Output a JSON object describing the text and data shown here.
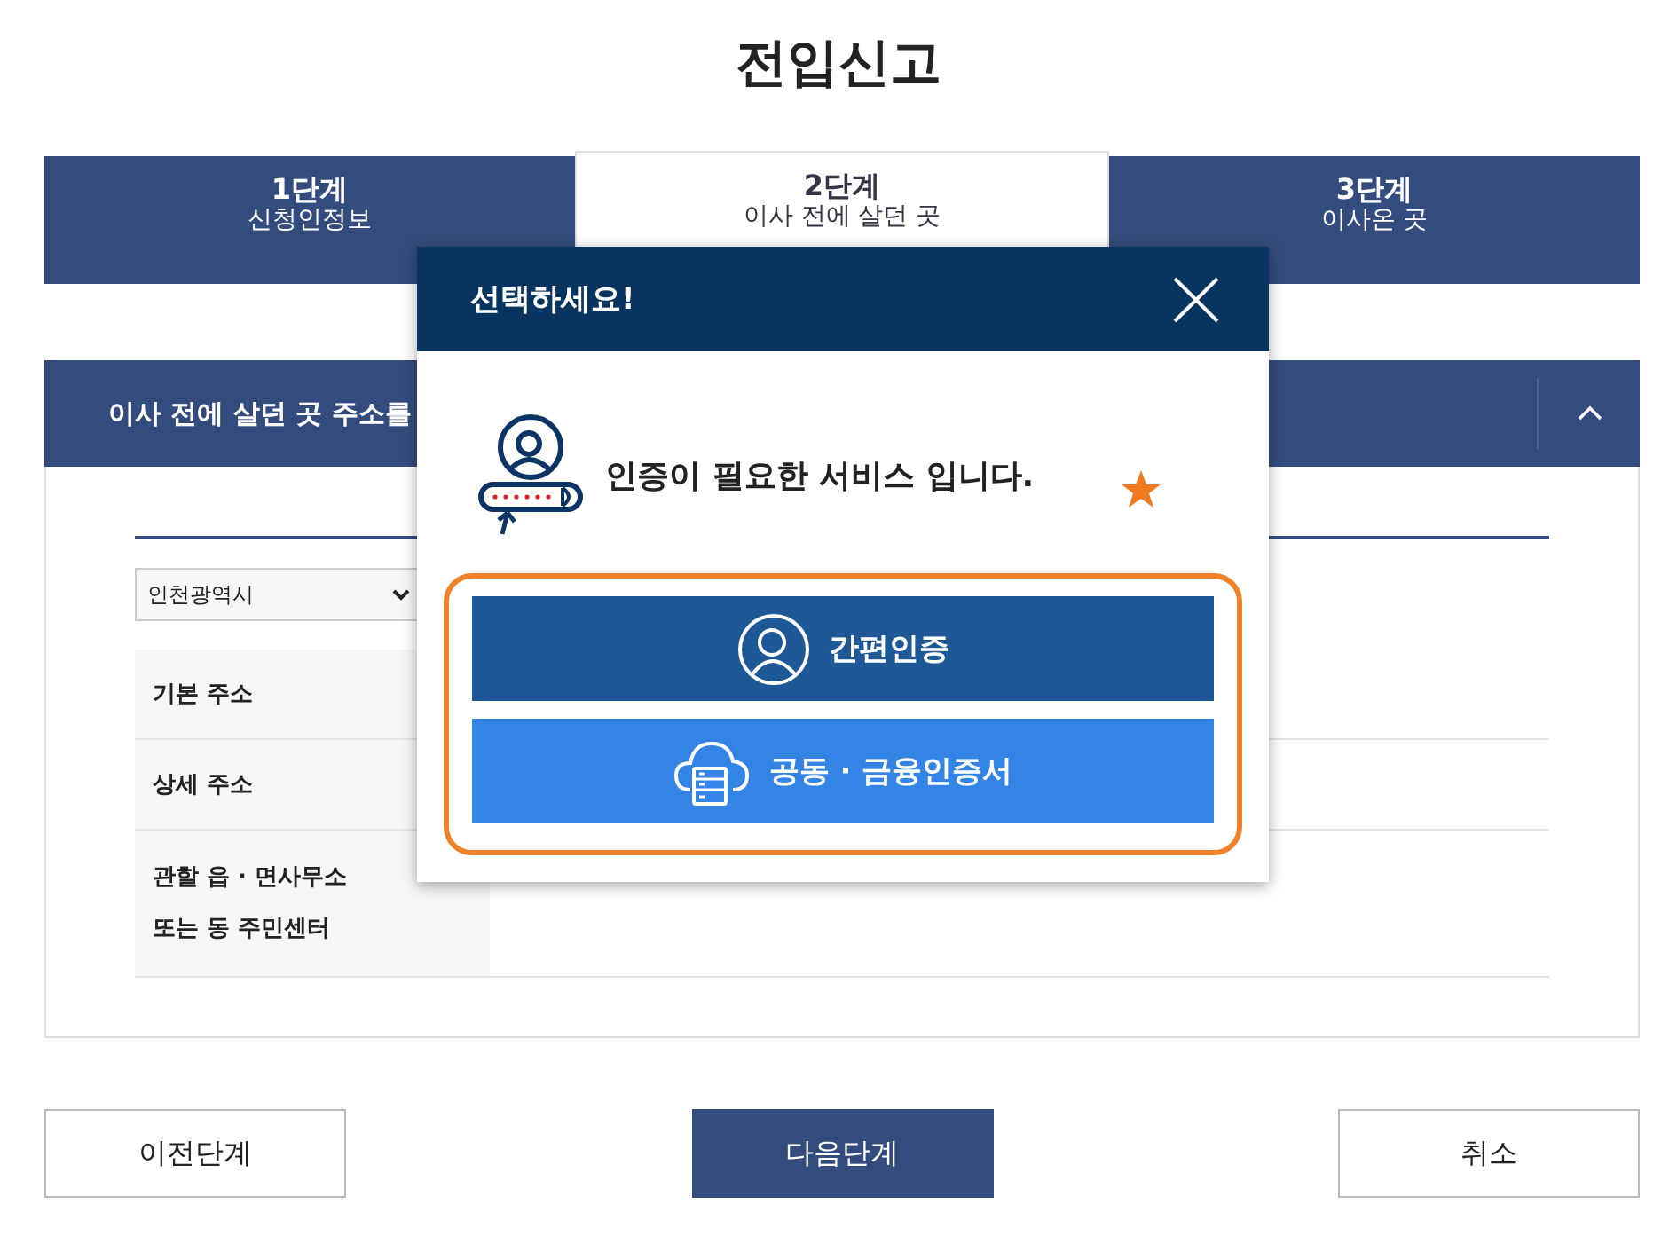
{
  "page_title": "전입신고",
  "steps": [
    {
      "number": "1단계",
      "label": "신청인정보",
      "selected": false
    },
    {
      "number": "2단계",
      "label": "이사 전에 살던 곳",
      "selected": true
    },
    {
      "number": "3단계",
      "label": "이사온 곳",
      "selected": false
    }
  ],
  "section": {
    "title": "이사 전에 살던 곳 주소를",
    "expanded": true,
    "region_select": {
      "value": "인천광역시"
    },
    "rows": [
      {
        "label_lines": [
          "기본 주소"
        ]
      },
      {
        "label_lines": [
          "상세 주소"
        ]
      },
      {
        "label_lines": [
          "관할 읍 · 면사무소",
          "또는 동 주민센터"
        ]
      }
    ]
  },
  "modal": {
    "title": "선택하세요!",
    "message": "인증이 필요한 서비스 입니다.",
    "options": [
      {
        "label": "간편인증",
        "kind": "simple"
      },
      {
        "label": "공동 · 금융인증서",
        "kind": "certificate"
      }
    ]
  },
  "buttons": [
    {
      "label": "이전단계",
      "kind": "secondary"
    },
    {
      "label": "다음단계",
      "kind": "primary"
    },
    {
      "label": "취소",
      "kind": "secondary"
    }
  ]
}
